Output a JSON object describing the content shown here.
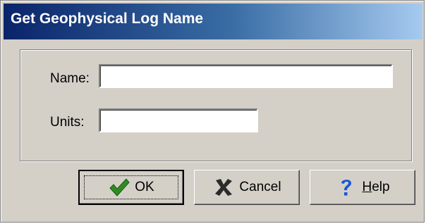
{
  "dialog": {
    "title": "Get Geophysical Log Name"
  },
  "form": {
    "name_label": "Name:",
    "name_value": "",
    "units_label": "Units:",
    "units_value": ""
  },
  "buttons": {
    "ok": {
      "label": "OK",
      "icon": "checkmark-icon",
      "icon_color": "#2e8b22"
    },
    "cancel": {
      "label": "Cancel",
      "icon": "x-icon",
      "icon_color": "#2b2b2b"
    },
    "help": {
      "label": "Help",
      "icon": "question-icon",
      "icon_color": "#1a55d6"
    }
  },
  "colors": {
    "title_gradient_start": "#0a246a",
    "title_gradient_end": "#a6caf0",
    "dialog_background": "#d4d0c8"
  }
}
